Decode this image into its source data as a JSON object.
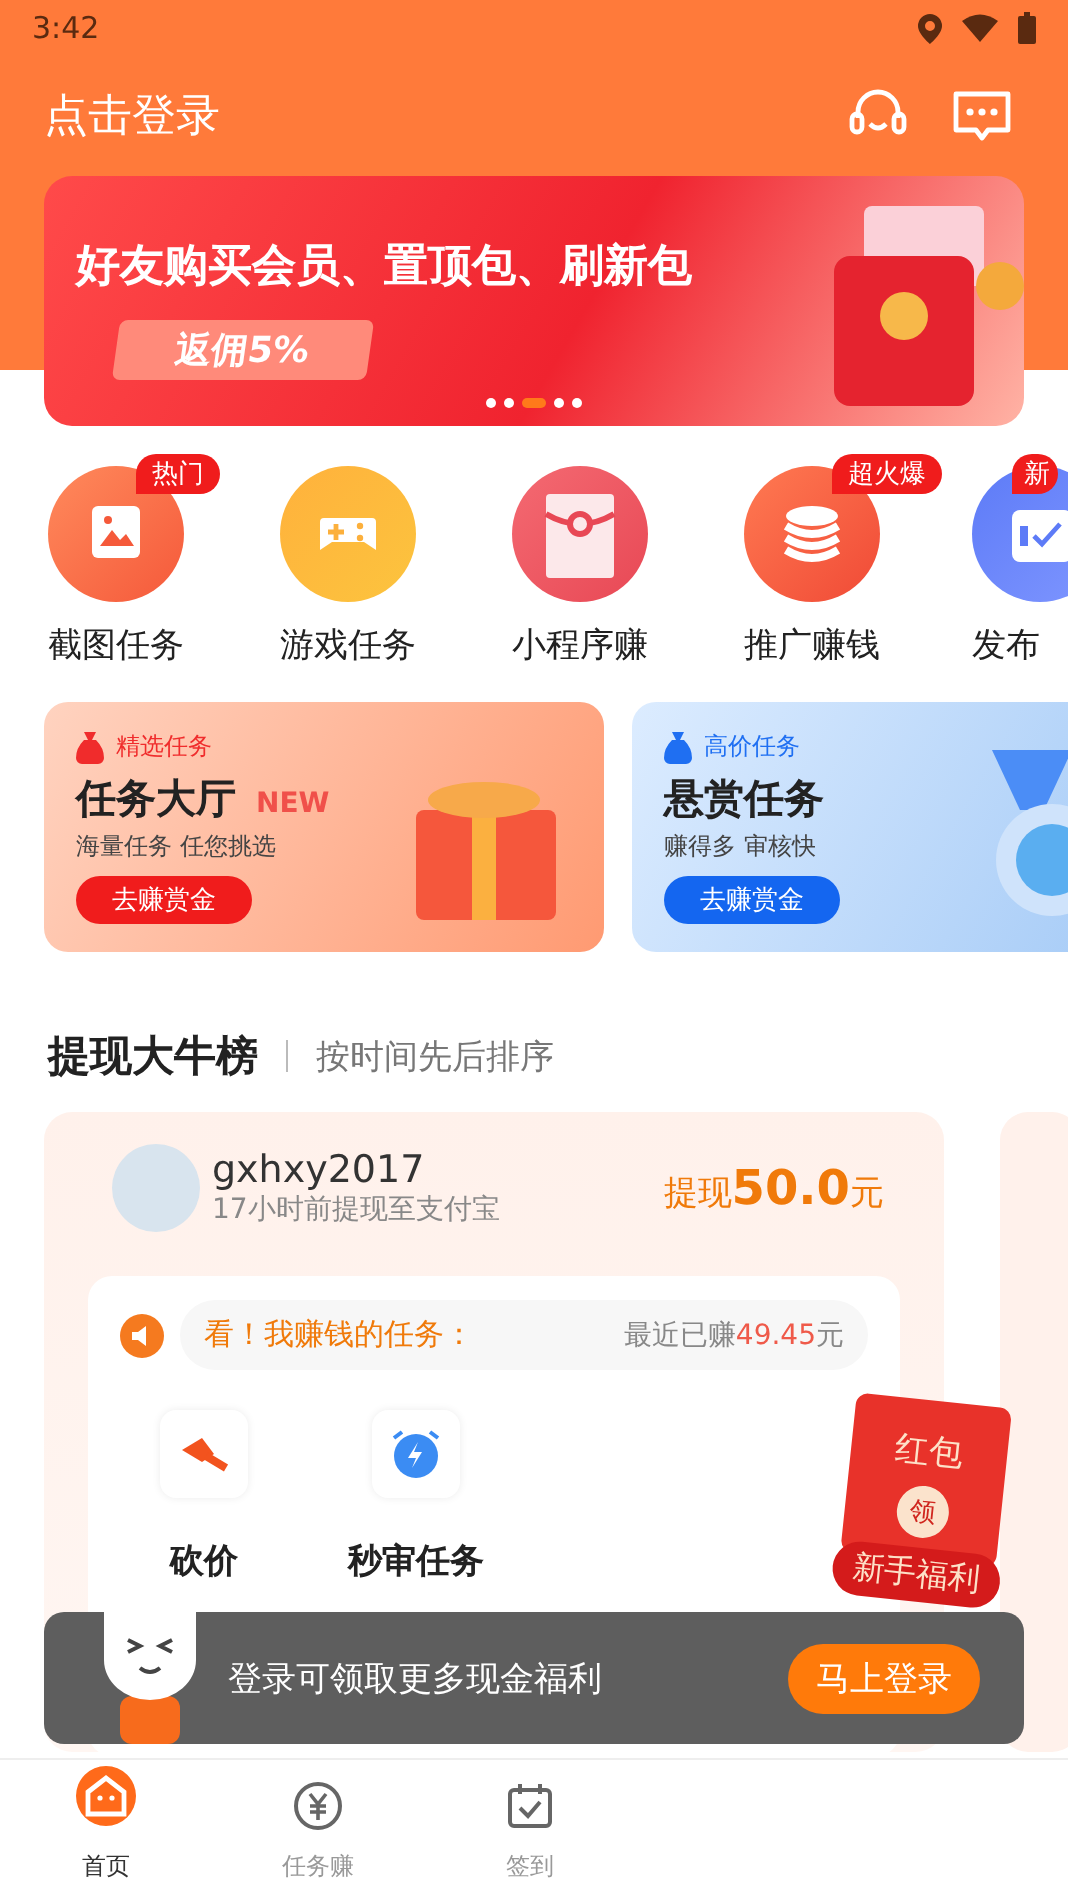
{
  "status_bar": {
    "time": "3:42"
  },
  "header": {
    "title": "点击登录"
  },
  "banner": {
    "headline": "好友购买会员、置顶包、刷新包",
    "ribbon": "返佣5%",
    "dots": [
      {
        "selected": false
      },
      {
        "selected": false
      },
      {
        "selected": true
      },
      {
        "selected": false
      },
      {
        "selected": false
      }
    ]
  },
  "shortcuts": [
    {
      "label": "截图任务",
      "badge": "热门",
      "kind": "screenshot"
    },
    {
      "label": "游戏任务",
      "kind": "game"
    },
    {
      "label": "小程序赚",
      "kind": "envelope"
    },
    {
      "label": "推广赚钱",
      "badge": "超火爆",
      "kind": "coins"
    },
    {
      "label": "发布",
      "badge": "新",
      "kind": "publish"
    }
  ],
  "promo_cards": [
    {
      "kind": "orange",
      "tag": "精选任务",
      "title": "任务大厅",
      "new_badge": "NEW",
      "subtitle": "海量任务  任您挑选",
      "button": "去赚赏金"
    },
    {
      "kind": "blue",
      "tag": "高价任务",
      "title": "悬赏任务",
      "subtitle": "赚得多 审核快",
      "button": "去赚赏金"
    }
  ],
  "leaderboard": {
    "title": "提现大牛榜",
    "subtitle": "按时间先后排序",
    "entry": {
      "username": "gxhxy2017",
      "detail": "17小时前提现至支付宝",
      "amount_prefix": "提现",
      "amount": "50.0",
      "amount_unit": "元",
      "ticker_label": "看！我赚钱的任务：",
      "recent_label": "最近已赚",
      "recent_amount": "49.45",
      "recent_unit": "元",
      "tasks": [
        {
          "name": "砍价",
          "kind": "bargain"
        },
        {
          "name": "秒审任务",
          "kind": "quick"
        }
      ]
    }
  },
  "floating_envelope": {
    "title": "红包",
    "seal": "领",
    "label": "新手福利"
  },
  "login_toast": {
    "message": "登录可领取更多现金福利",
    "button": "马上登录"
  },
  "tab_bar": [
    {
      "label": "首页",
      "selected": true,
      "kind": "home"
    },
    {
      "label": "任务赚",
      "selected": false,
      "kind": "coin"
    },
    {
      "label": "签到",
      "selected": false,
      "kind": "calendar"
    }
  ]
}
